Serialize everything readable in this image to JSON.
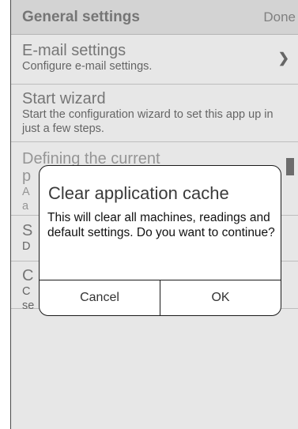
{
  "header": {
    "title": "General settings",
    "done_label": "Done"
  },
  "rows": [
    {
      "title": "E-mail settings",
      "desc": "Configure e-mail settings."
    },
    {
      "title": "Start wizard",
      "desc": "Start the configuration wizard to set this app up in just a few steps."
    },
    {
      "title": "Defining the current",
      "title_line2": "p",
      "desc_fragments": [
        "A",
        "a"
      ]
    },
    {
      "title": "S",
      "desc": "D"
    },
    {
      "title": "C",
      "desc": "C",
      "desc_line2": "se"
    }
  ],
  "dialog": {
    "title": "Clear application cache",
    "message": "This will clear all machines, readings and default settings. Do you want to continue?",
    "cancel_label": "Cancel",
    "ok_label": "OK"
  },
  "icons": {
    "chevron": "chevron-right-icon"
  },
  "colors": {
    "header_bg": "#c9c9c9",
    "list_bg": "#e8e8e8",
    "dialog_bg": "#ffffff"
  }
}
